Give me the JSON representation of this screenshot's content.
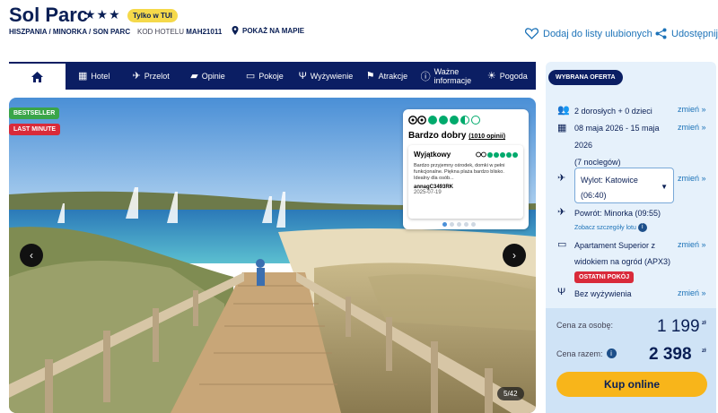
{
  "header": {
    "title": "Sol Parc",
    "stars": "★★★",
    "badge": "Tylko w TUI",
    "breadcrumb": "HISZPANIA / MINORKA / SON PARC",
    "hotel_code_label": "KOD HOTELU",
    "hotel_code": "MAH21011",
    "map_link": "POKAŻ NA MAPIE",
    "favorites": "Dodaj do listy ulubionych",
    "share": "Udostępnij"
  },
  "nav": {
    "home_icon": "home-icon",
    "items": [
      {
        "label": "Hotel",
        "icon": "hotel-icon"
      },
      {
        "label": "Przelot",
        "icon": "plane-icon"
      },
      {
        "label": "Opinie",
        "icon": "comment-icon"
      },
      {
        "label": "Pokoje",
        "icon": "bed-icon"
      },
      {
        "label": "Wyżywienie",
        "icon": "cutlery-icon"
      },
      {
        "label": "Atrakcje",
        "icon": "attractions-icon"
      },
      {
        "label": "Ważne informacje",
        "icon": "info-icon"
      },
      {
        "label": "Pogoda",
        "icon": "sun-icon"
      }
    ]
  },
  "gallery": {
    "tag_bestseller": "BESTSELLER",
    "tag_lastminute": "LAST MINUTE",
    "counter": "5/42",
    "colors": {
      "bestseller": "#3aa548",
      "lastminute": "#d92b3a"
    }
  },
  "review": {
    "rating_label": "Bardzo dobry",
    "opinions": "(1010 opinii)",
    "score_circles": 3.5,
    "card_title": "Wyjątkowy",
    "card_text": "Bardzo przyjemny ośrodek, domki w pełni funkcjonalne. Piękna plaża bardzo blisko. Idealny dla osób...",
    "author": "annagC3493RK",
    "date": "2025-07-19"
  },
  "offer": {
    "badge": "WYBRANA OFERTA",
    "people": "2 dorosłych + 0 dzieci",
    "dates_line1": "08 maja 2026 - 15 maja",
    "dates_line2": "2026",
    "nights": "(7 noclegów)",
    "departure_line1": "Wylot: Katowice",
    "departure_line2": "(06:40)",
    "return": "Powrót: Minorka (09:55)",
    "flight_details": "Zobacz szczegóły lotu",
    "room_line1": "Apartament Superior z",
    "room_line2": "widokiem na ogród (APX3)",
    "last_rooms": "OSTATNI POKÓJ",
    "board": "Bez wyżywienia",
    "change": "zmień »",
    "price_per_person_label": "Cena za osobę:",
    "price_per_person": "1 199",
    "price_total_label": "Cena razem:",
    "price_total": "2 398",
    "currency": "zł",
    "buy": "Kup online"
  }
}
